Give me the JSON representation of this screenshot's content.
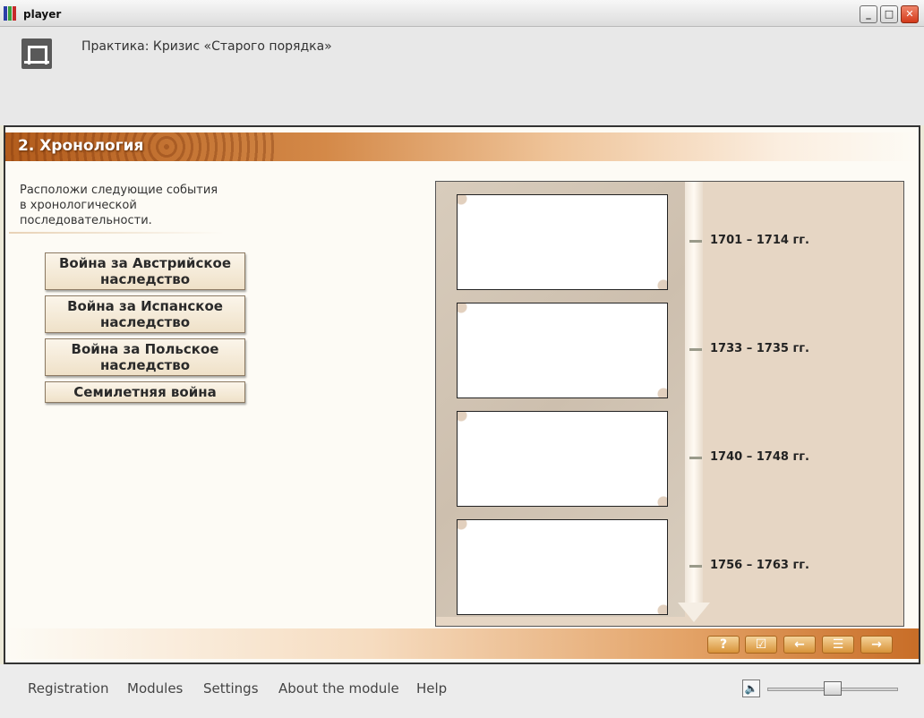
{
  "window": {
    "title": "player",
    "controls": {
      "minimize": "_",
      "maximize": "□",
      "close": "✕"
    }
  },
  "header": {
    "course_title": "Практика: Кризис «Старого порядка»"
  },
  "section": {
    "title": "2. Хронология"
  },
  "instructions": "Расположи следующие события в хронологической последовательности.",
  "events": [
    "Война за Австрийское наследство",
    "Война за Испанское наследство",
    "Война за Польское наследство",
    "Семилетняя война"
  ],
  "timeline": {
    "dates": [
      "1701 – 1714 гг.",
      "1733 – 1735 гг.",
      "1740 – 1748 гг.",
      "1756 – 1763 гг."
    ]
  },
  "nav_buttons": [
    {
      "name": "help",
      "glyph": "?"
    },
    {
      "name": "check",
      "glyph": "☑"
    },
    {
      "name": "back",
      "glyph": "←"
    },
    {
      "name": "menu",
      "glyph": "☰"
    },
    {
      "name": "forward",
      "glyph": "→"
    }
  ],
  "volume": {
    "speaker_glyph": "🔈",
    "level": 0.5
  },
  "footer": {
    "links": [
      "Registration",
      "Modules",
      "Settings",
      "About the module",
      "Help"
    ]
  },
  "colors": {
    "accent_orange": "#c86d27",
    "title_bar": "#dcdcdc"
  }
}
